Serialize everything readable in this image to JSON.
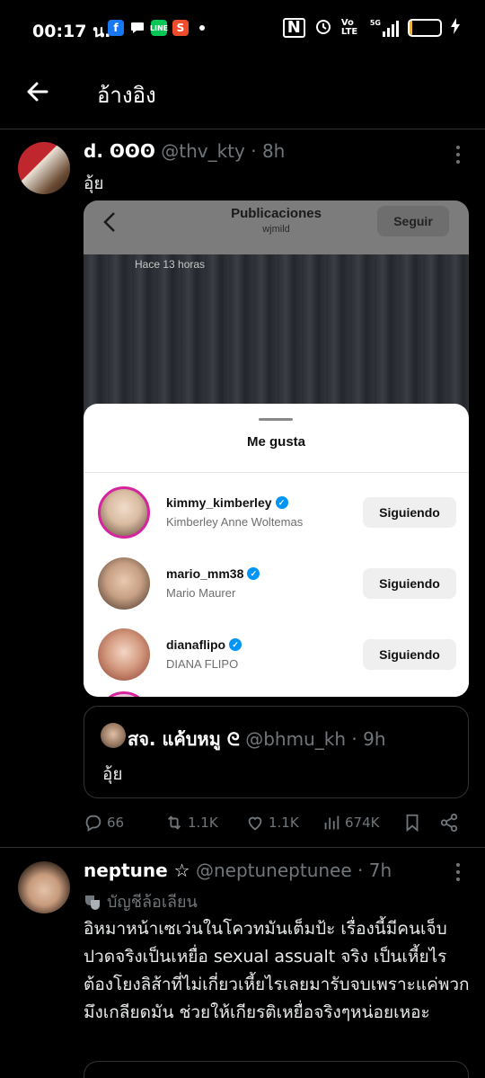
{
  "status_bar": {
    "time": "00:17 น.",
    "icons": [
      "facebook-icon",
      "chat-bubble-icon",
      "line-icon",
      "shopee-icon"
    ],
    "volte": "Vo LTE",
    "network": "5G",
    "battery": "8",
    "battery_level": 0.08
  },
  "header": {
    "title": "อ้างอิง",
    "back_icon": "arrow-left-icon"
  },
  "tweet1": {
    "name": "d. ʘʘʘ",
    "handle": "@thv_kty",
    "time": "· 8h",
    "text": "อุ้ย",
    "embed": {
      "ig_title": "Publicaciones",
      "ig_user": "wjmild",
      "ig_follow": "Seguir",
      "ig_time": "Hace 13 horas",
      "sheet_title": "Me gusta",
      "likes": [
        {
          "username": "kimmy_kimberley",
          "fullname": "Kimberley Anne Woltemas",
          "button": "Siguiendo"
        },
        {
          "username": "mario_mm38",
          "fullname": "Mario Maurer",
          "button": "Siguiendo"
        },
        {
          "username": "dianaflipo",
          "fullname": "DIANA FLIPO",
          "button": "Siguiendo"
        }
      ]
    },
    "quote": {
      "name": "สจ. แค้บหมู ᘓ",
      "handle": "@bhmu_kh",
      "time": "· 9h",
      "text": "อุ้ย"
    },
    "actions": {
      "replies": "66",
      "retweets": "1.1K",
      "likes": "1.1K",
      "views": "674K"
    }
  },
  "tweet2": {
    "name": "neptune ☆",
    "handle": "@neptuneptunee",
    "time": "· 7h",
    "label": "บัญชีล้อเลียน",
    "text": "อิหมาหน้าเซเว่นในโควทมันเต็มป้ะ เรื่องนี้มีคนเจ็บปวดจริงเป็นเหยื่อ sexual assualt จริง เป็นเหี้ยไรต้องโยงลิส้าที่ไม่เกี่ยวเหี้ยไรเลยมารับจบเพราะแค่พวกมึงเกลียดมัน ช่วยให้เกียรติเหยื่อจริงๆหน่อยเหอะ"
  }
}
